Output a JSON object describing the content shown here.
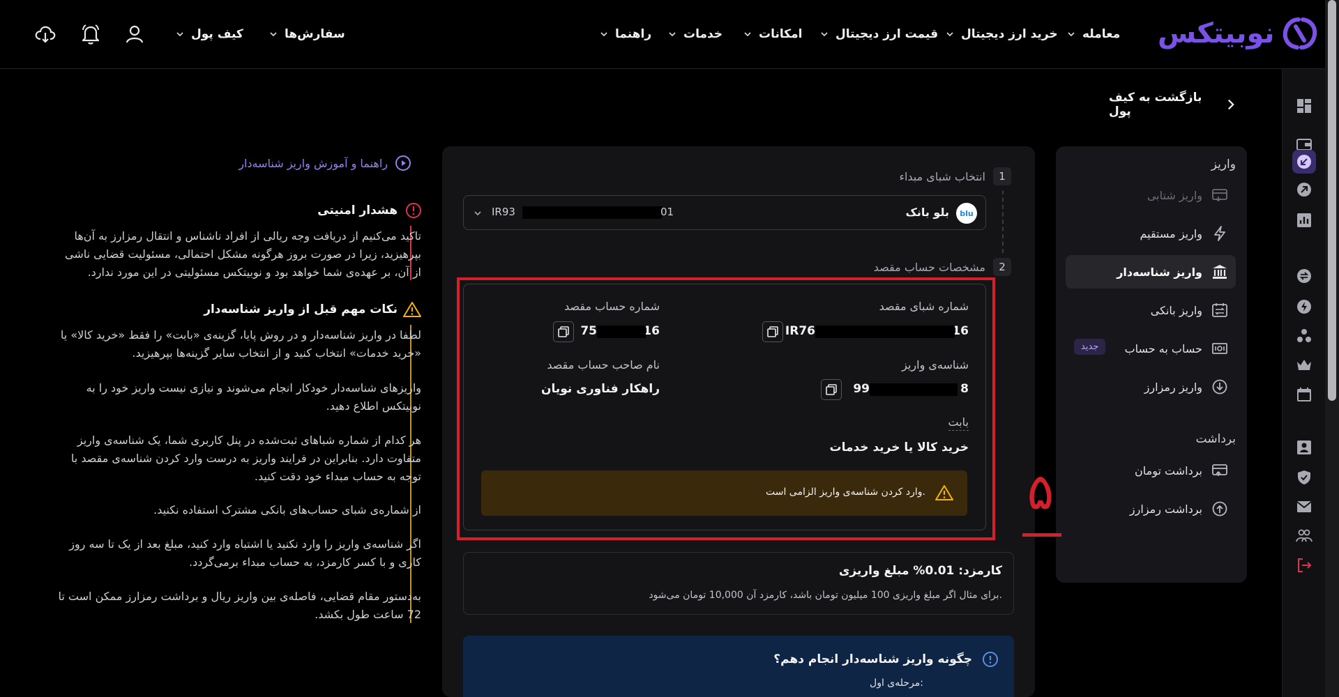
{
  "brand": {
    "name": "نوبیتکس",
    "accent": "#7b52e8"
  },
  "topnav": {
    "items": [
      "معامله",
      "خرید ارز دیجیتال",
      "قیمت ارز دیجیتال",
      "امکانات",
      "خدمات",
      "راهنما"
    ],
    "user_items": [
      "سفارش‌ها",
      "کیف پول"
    ],
    "icons": [
      "user-icon",
      "bell-icon",
      "cloud-download-icon"
    ]
  },
  "back_link": "بازگشت به کیف پول",
  "sidemenu": {
    "deposit_header": "واریز",
    "deposit_items": [
      {
        "label": "واریز شتابی",
        "icon": "card-transfer-icon",
        "state": "disabled"
      },
      {
        "label": "واریز مستقیم",
        "icon": "lightning-icon",
        "state": "normal"
      },
      {
        "label": "واریز شناسه‌دار",
        "icon": "bank-icon",
        "state": "active"
      },
      {
        "label": "واریز بانکی",
        "icon": "calendar-transfer-icon",
        "state": "normal"
      },
      {
        "label": "حساب به حساب",
        "icon": "money-card-icon",
        "state": "normal",
        "badge": "جدید"
      },
      {
        "label": "واریز رمزارز",
        "icon": "download-circle-icon",
        "state": "normal"
      }
    ],
    "withdraw_header": "برداشت",
    "withdraw_items": [
      {
        "label": "برداشت تومان",
        "icon": "card-transfer-icon"
      },
      {
        "label": "برداشت رمزارز",
        "icon": "upload-circle-icon"
      }
    ]
  },
  "step1": {
    "number": "1",
    "title": "انتخاب شبای مبداء",
    "bank_name": "بلو بانک",
    "bank_logo_text": "blu",
    "iban_prefix": "IR93",
    "iban_suffix": "01"
  },
  "step2": {
    "number": "2",
    "title": "مشخصات حساب مقصد",
    "dest_iban_label": "شماره شبای مقصد",
    "dest_iban_prefix": "IR76",
    "dest_iban_suffix": "16",
    "dest_account_label": "شماره حساب مقصد",
    "dest_account_prefix": "75",
    "dest_account_suffix": "16",
    "deposit_id_label": "شناسه‌ی واریز",
    "deposit_id_prefix": "99",
    "deposit_id_suffix": "8",
    "owner_label": "نام صاحب حساب مقصد",
    "owner_value": "راهکار فناوری نویان",
    "purpose_label": "بابت",
    "purpose_value": "خرید کالا یا خرید خدمات",
    "warning": "وارد کردن شناسه‌ی واریز الزامی است."
  },
  "annotation_number": "۵",
  "fee": {
    "title": "کارمزد: 0.01% مبلغ واریزی",
    "desc": "برای مثال اگر مبلغ واریزی 100 میلیون تومان باشد، کارمزد آن 10,000 تومان می‌شود."
  },
  "howto": {
    "title": "چگونه واریز شناسه‌دار انجام دهم؟",
    "step_label": "مرحله‌ی اول:"
  },
  "guide_link": "راهنما و آموزش واریز شناسه‌دار",
  "security": {
    "title": "هشدار امنیتی",
    "text": "تاکید می‌کنیم از دریافت وجه ریالی از افراد ناشناس و انتقال رمزارز به آن‌ها بپرهیزید، زیرا در صورت بروز هرگونه مشکل احتمالی، مسئولیت قضایی ناشی از آن، بر عهده‌ی شما خواهد بود و نوبیتکس مسئولیتی در این مورد ندارد."
  },
  "tips": {
    "title": "نکات مهم قبل از واریز شناسه‌دار",
    "paragraphs": [
      "لطفا در واریز شناسه‌دار و در روش پایا، گزینه‌ی «بابت» را فقط «خرید کالا» یا «خرید خدمات» انتخاب کنید و از انتخاب سایر گزینه‌ها بپرهیزید.",
      "واریزهای شناسه‌دار خودکار انجام می‌شوند و نیازی نیست واریز خود را به نوبیتکس اطلاع دهید.",
      "هر کدام از شماره شباهای ثبت‌شده در پنل کاربری شما، یک شناسه‌ی واریز متفاوت دارد. بنابراین در فرایند واریز به درست وارد کردن شناسه‌ی مقصد با توجه به حساب مبداء خود دقت کنید.",
      "از شماره‌ی شبای حساب‌های بانکی مشترک استفاده نکنید.",
      "اگر شناسه‌ی واریز را وارد نکنید یا اشتباه وارد کنید، مبلغ بعد از یک تا سه روز کاری و با کسر کارمزد، به حساب مبداء برمی‌گردد.",
      "به‌دستور مقام قضایی، فاصله‌ی بین واریز ریال و برداشت رمزارز ممکن است تا 72 ساعت طول بکشد."
    ]
  },
  "colors": {
    "highlight": "#d51f2a",
    "warning_bg": "#3a2a0b",
    "warning_icon": "#f5b400",
    "danger": "#e0324a"
  }
}
